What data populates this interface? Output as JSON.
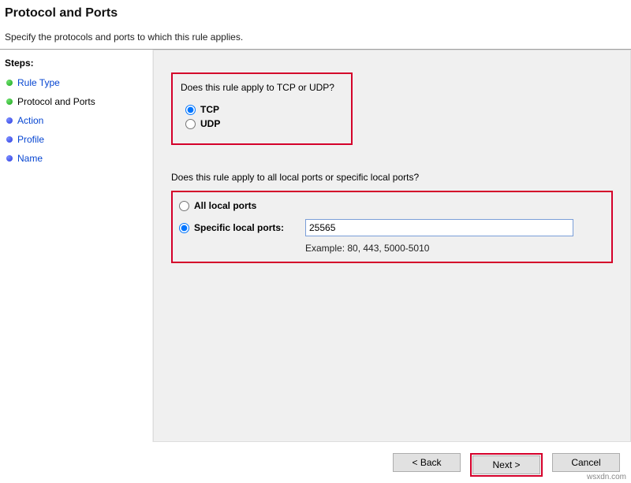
{
  "header": {
    "title": "Protocol and Ports",
    "subtitle": "Specify the protocols and ports to which this rule applies."
  },
  "sidebar": {
    "title": "Steps:",
    "items": [
      {
        "label": "Rule Type",
        "state": "done",
        "link": true
      },
      {
        "label": "Protocol and Ports",
        "state": "done",
        "link": false
      },
      {
        "label": "Action",
        "state": "todo",
        "link": true
      },
      {
        "label": "Profile",
        "state": "todo",
        "link": true
      },
      {
        "label": "Name",
        "state": "todo",
        "link": true
      }
    ]
  },
  "main": {
    "question_protocol": "Does this rule apply to TCP or UDP?",
    "radio_tcp": "TCP",
    "radio_udp": "UDP",
    "protocol_selected": "tcp",
    "question_ports": "Does this rule apply to all local ports or specific local ports?",
    "radio_all_ports": "All local ports",
    "radio_specific_ports": "Specific local ports:",
    "ports_selected": "specific",
    "port_value": "25565",
    "example_label": "Example: 80, 443, 5000-5010"
  },
  "footer": {
    "back": "< Back",
    "next": "Next >",
    "cancel": "Cancel"
  },
  "watermark": "wsxdn.com"
}
